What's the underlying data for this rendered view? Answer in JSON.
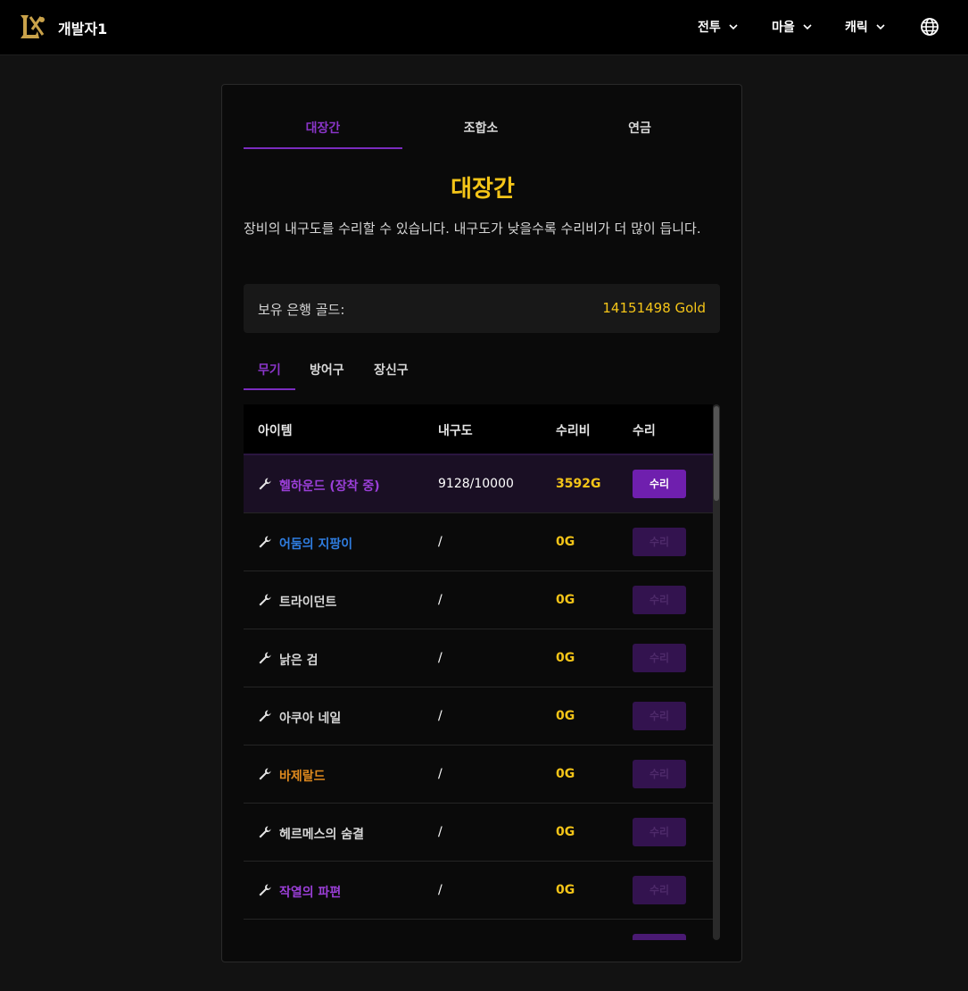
{
  "header": {
    "username": "개발자1",
    "nav": [
      "전투",
      "마을",
      "캐릭"
    ]
  },
  "main_tabs": [
    "대장간",
    "조합소",
    "연금"
  ],
  "title": "대장간",
  "description": "장비의 내구도를 수리할 수 있습니다. 내구도가 낮을수록 수리비가 더 많이 듭니다.",
  "gold": {
    "label": "보유 은행 골드:",
    "value": "14151498 Gold"
  },
  "sub_tabs": [
    "무기",
    "방어구",
    "장신구"
  ],
  "table": {
    "headers": [
      "아이템",
      "내구도",
      "수리비",
      "수리"
    ],
    "rows": [
      {
        "name": "헬하운드 (장착 중)",
        "durability": "9128/10000",
        "cost": "3592G",
        "button": "수리",
        "color": "#9b3fd8"
      },
      {
        "name": "어둠의 지팡이",
        "durability": "/",
        "cost": "0G",
        "button": "수리",
        "color": "#2f7de0"
      },
      {
        "name": "트라이던트",
        "durability": "/",
        "cost": "0G",
        "button": "수리",
        "color": "#d6d6d6"
      },
      {
        "name": "낡은 검",
        "durability": "/",
        "cost": "0G",
        "button": "수리",
        "color": "#d6d6d6"
      },
      {
        "name": "아쿠아 네일",
        "durability": "/",
        "cost": "0G",
        "button": "수리",
        "color": "#d6d6d6"
      },
      {
        "name": "바제랄드",
        "durability": "/",
        "cost": "0G",
        "button": "수리",
        "color": "#e08a1e"
      },
      {
        "name": "헤르메스의 숨결",
        "durability": "/",
        "cost": "0G",
        "button": "수리",
        "color": "#d6d6d6"
      },
      {
        "name": "작열의 파편",
        "durability": "/",
        "cost": "0G",
        "button": "수리",
        "color": "#9b3fd8"
      }
    ]
  },
  "colors": {
    "accent": "#7b2cbf",
    "gold": "#f5c518"
  },
  "icons": [
    "logo-icon",
    "chevron-down-icon",
    "globe-icon",
    "wrench-icon"
  ]
}
